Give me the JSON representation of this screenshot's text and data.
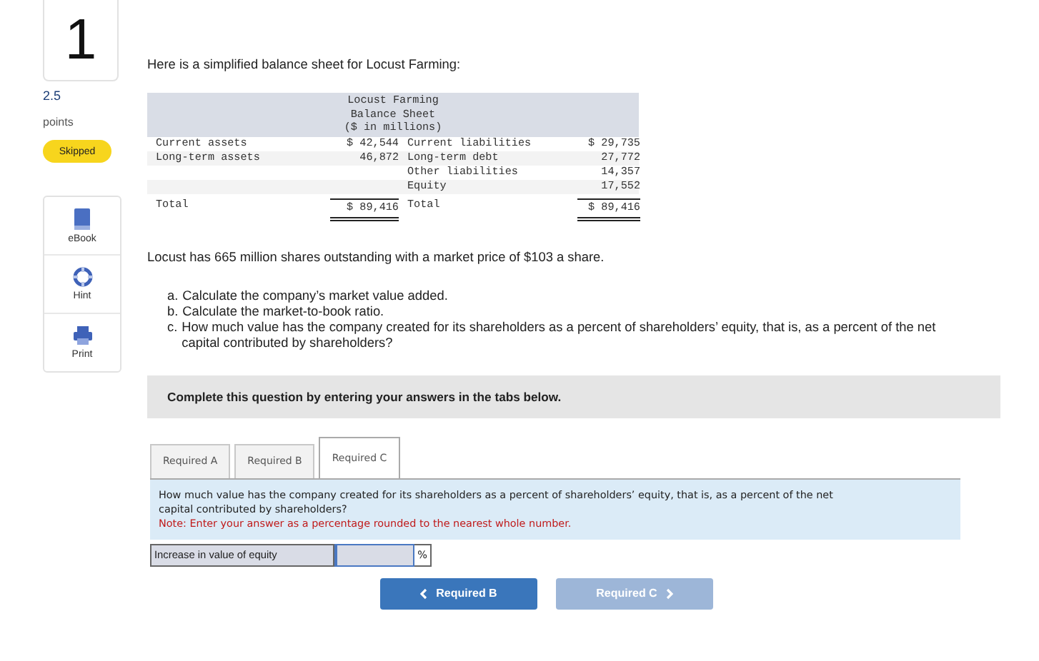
{
  "question": {
    "number": "1",
    "points": "2.5",
    "points_label": "points",
    "status": "Skipped"
  },
  "tools": [
    {
      "kind": "book",
      "label": "eBook"
    },
    {
      "kind": "lifebuoy",
      "label": "Hint"
    },
    {
      "kind": "printer",
      "label": "Print"
    }
  ],
  "intro": "Here is a simplified balance sheet for Locust Farming:",
  "balance_sheet": {
    "title_lines": [
      "Locust Farming",
      "Balance Sheet",
      "($ in millions)"
    ],
    "rows": [
      {
        "kind": "item",
        "col_1": "Current assets",
        "col_2": "$ 42,544",
        "col_3": "Current liabilities",
        "col_4": "$ 29,735"
      },
      {
        "kind": "item",
        "col_1": "Long-term assets",
        "col_2": "46,872",
        "col_3": "Long-term debt",
        "col_4": "27,772"
      },
      {
        "kind": "item",
        "col_3": "Other liabilities",
        "col_4": "14,357"
      },
      {
        "kind": "item",
        "col_3": "Equity",
        "col_4": "17,552"
      },
      {
        "kind": "total",
        "col_1": "Total",
        "col_2": "$ 89,416",
        "col_3": "Total",
        "col_4": "$ 89,416"
      }
    ]
  },
  "market_text": "Locust has 665 million shares outstanding with a market price of $103 a share.",
  "parts": [
    {
      "marker": "a.",
      "text": "Calculate the company’s market value added."
    },
    {
      "marker": "b.",
      "text": "Calculate the market-to-book ratio."
    },
    {
      "marker": "c.",
      "text": "How much value has the company created for its shareholders as a percent of shareholders’ equity, that is, as a percent of the net capital contributed by shareholders?"
    }
  ],
  "instruction": "Complete this question by entering your answers in the tabs below.",
  "tabs": [
    {
      "label": "Required A",
      "selected": false
    },
    {
      "label": "Required B",
      "selected": false
    },
    {
      "label": "Required C",
      "selected": true
    }
  ],
  "tab_panel": {
    "question": "How much value has the company created for its shareholders as a percent of shareholders’ equity, that is, as a percent of the net capital contributed by shareholders?",
    "note": "Note: Enter your answer as a percentage rounded to the nearest whole number."
  },
  "answer_row": {
    "label": "Increase in value of equity",
    "unit": "%"
  },
  "nav_buttons": [
    {
      "kind": "back",
      "label": "Required B",
      "disabled": false
    },
    {
      "kind": "next",
      "label": "Required C",
      "disabled": true
    }
  ]
}
